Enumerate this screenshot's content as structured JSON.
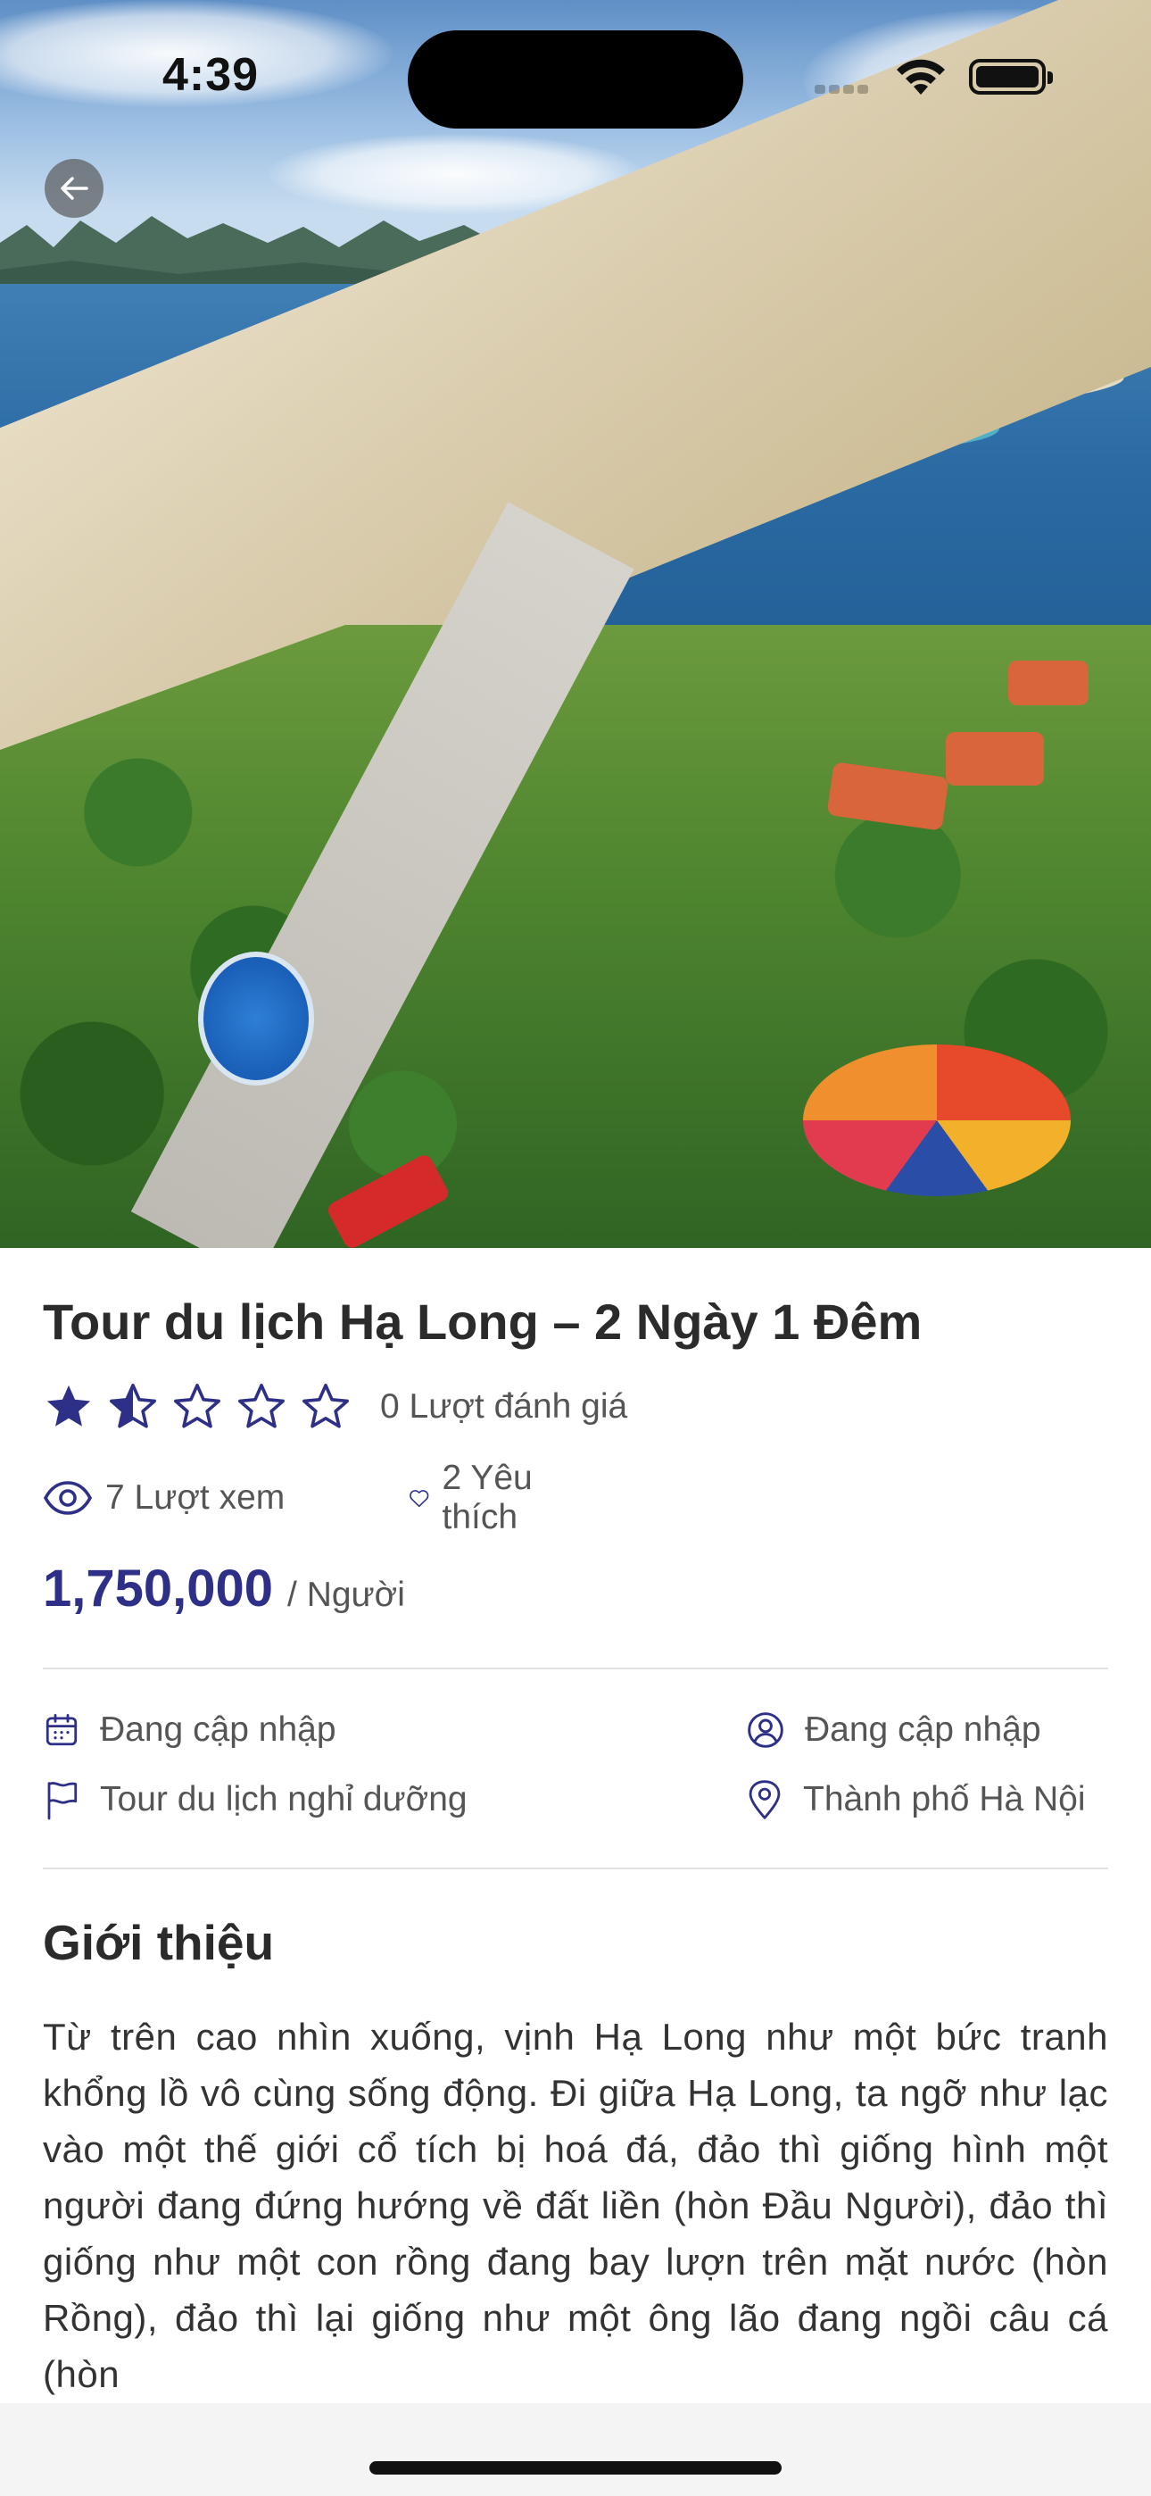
{
  "status_bar": {
    "time": "4:39"
  },
  "navigation": {
    "back_icon": "arrow-left-icon"
  },
  "tour": {
    "title": "Tour du lịch Hạ Long – 2 Ngày 1 Đêm",
    "rating": {
      "stars_filled": 1.5,
      "stars_total": 5,
      "count_label": "0 Lượt đánh giá"
    },
    "views_label": "7 Lượt xem",
    "likes_label": "2 Yêu thích",
    "price": "1,750,000",
    "price_unit": "/ Người",
    "details": {
      "start_date": "Đang cập nhập",
      "guide": "Đang cập nhập",
      "category": "Tour du lịch nghỉ dưỡng",
      "location": "Thành phố Hà Nội"
    }
  },
  "intro": {
    "heading": "Giới thiệu",
    "text": "Từ trên cao nhìn xuống, vịnh Hạ Long như một bức tranh khổng lồ vô cùng sống động. Đi giữa Hạ Long, ta ngỡ như lạc vào một thế giới cổ tích bị hoá đá, đảo thì giống hình một người đang đứng hướng về đất liền (hòn Đầu Người), đảo thì giống như một con rồng đang bay lượn trên mặt nước (hòn Rồng), đảo thì lại giống như một ông lão đang ngồi câu cá (hòn"
  },
  "colors": {
    "accent": "#2e2f86",
    "text": "#333333",
    "muted": "#555555",
    "divider": "#e2e2e2"
  }
}
